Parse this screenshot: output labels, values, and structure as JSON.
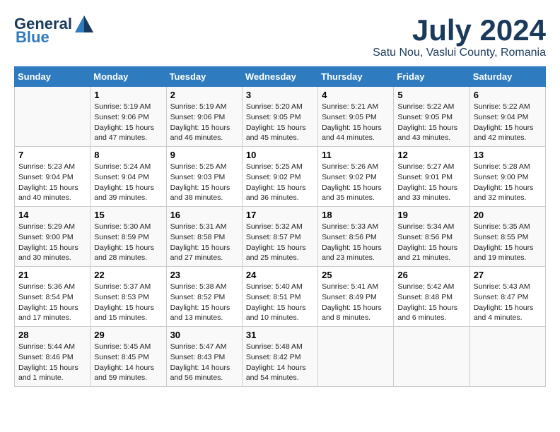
{
  "header": {
    "logo_general": "General",
    "logo_blue": "Blue",
    "month": "July 2024",
    "location": "Satu Nou, Vaslui County, Romania"
  },
  "days_of_week": [
    "Sunday",
    "Monday",
    "Tuesday",
    "Wednesday",
    "Thursday",
    "Friday",
    "Saturday"
  ],
  "weeks": [
    [
      {
        "day": "",
        "sunrise": "",
        "sunset": "",
        "daylight": ""
      },
      {
        "day": "1",
        "sunrise": "Sunrise: 5:19 AM",
        "sunset": "Sunset: 9:06 PM",
        "daylight": "Daylight: 15 hours and 47 minutes."
      },
      {
        "day": "2",
        "sunrise": "Sunrise: 5:19 AM",
        "sunset": "Sunset: 9:06 PM",
        "daylight": "Daylight: 15 hours and 46 minutes."
      },
      {
        "day": "3",
        "sunrise": "Sunrise: 5:20 AM",
        "sunset": "Sunset: 9:05 PM",
        "daylight": "Daylight: 15 hours and 45 minutes."
      },
      {
        "day": "4",
        "sunrise": "Sunrise: 5:21 AM",
        "sunset": "Sunset: 9:05 PM",
        "daylight": "Daylight: 15 hours and 44 minutes."
      },
      {
        "day": "5",
        "sunrise": "Sunrise: 5:22 AM",
        "sunset": "Sunset: 9:05 PM",
        "daylight": "Daylight: 15 hours and 43 minutes."
      },
      {
        "day": "6",
        "sunrise": "Sunrise: 5:22 AM",
        "sunset": "Sunset: 9:04 PM",
        "daylight": "Daylight: 15 hours and 42 minutes."
      }
    ],
    [
      {
        "day": "7",
        "sunrise": "Sunrise: 5:23 AM",
        "sunset": "Sunset: 9:04 PM",
        "daylight": "Daylight: 15 hours and 40 minutes."
      },
      {
        "day": "8",
        "sunrise": "Sunrise: 5:24 AM",
        "sunset": "Sunset: 9:04 PM",
        "daylight": "Daylight: 15 hours and 39 minutes."
      },
      {
        "day": "9",
        "sunrise": "Sunrise: 5:25 AM",
        "sunset": "Sunset: 9:03 PM",
        "daylight": "Daylight: 15 hours and 38 minutes."
      },
      {
        "day": "10",
        "sunrise": "Sunrise: 5:25 AM",
        "sunset": "Sunset: 9:02 PM",
        "daylight": "Daylight: 15 hours and 36 minutes."
      },
      {
        "day": "11",
        "sunrise": "Sunrise: 5:26 AM",
        "sunset": "Sunset: 9:02 PM",
        "daylight": "Daylight: 15 hours and 35 minutes."
      },
      {
        "day": "12",
        "sunrise": "Sunrise: 5:27 AM",
        "sunset": "Sunset: 9:01 PM",
        "daylight": "Daylight: 15 hours and 33 minutes."
      },
      {
        "day": "13",
        "sunrise": "Sunrise: 5:28 AM",
        "sunset": "Sunset: 9:00 PM",
        "daylight": "Daylight: 15 hours and 32 minutes."
      }
    ],
    [
      {
        "day": "14",
        "sunrise": "Sunrise: 5:29 AM",
        "sunset": "Sunset: 9:00 PM",
        "daylight": "Daylight: 15 hours and 30 minutes."
      },
      {
        "day": "15",
        "sunrise": "Sunrise: 5:30 AM",
        "sunset": "Sunset: 8:59 PM",
        "daylight": "Daylight: 15 hours and 28 minutes."
      },
      {
        "day": "16",
        "sunrise": "Sunrise: 5:31 AM",
        "sunset": "Sunset: 8:58 PM",
        "daylight": "Daylight: 15 hours and 27 minutes."
      },
      {
        "day": "17",
        "sunrise": "Sunrise: 5:32 AM",
        "sunset": "Sunset: 8:57 PM",
        "daylight": "Daylight: 15 hours and 25 minutes."
      },
      {
        "day": "18",
        "sunrise": "Sunrise: 5:33 AM",
        "sunset": "Sunset: 8:56 PM",
        "daylight": "Daylight: 15 hours and 23 minutes."
      },
      {
        "day": "19",
        "sunrise": "Sunrise: 5:34 AM",
        "sunset": "Sunset: 8:56 PM",
        "daylight": "Daylight: 15 hours and 21 minutes."
      },
      {
        "day": "20",
        "sunrise": "Sunrise: 5:35 AM",
        "sunset": "Sunset: 8:55 PM",
        "daylight": "Daylight: 15 hours and 19 minutes."
      }
    ],
    [
      {
        "day": "21",
        "sunrise": "Sunrise: 5:36 AM",
        "sunset": "Sunset: 8:54 PM",
        "daylight": "Daylight: 15 hours and 17 minutes."
      },
      {
        "day": "22",
        "sunrise": "Sunrise: 5:37 AM",
        "sunset": "Sunset: 8:53 PM",
        "daylight": "Daylight: 15 hours and 15 minutes."
      },
      {
        "day": "23",
        "sunrise": "Sunrise: 5:38 AM",
        "sunset": "Sunset: 8:52 PM",
        "daylight": "Daylight: 15 hours and 13 minutes."
      },
      {
        "day": "24",
        "sunrise": "Sunrise: 5:40 AM",
        "sunset": "Sunset: 8:51 PM",
        "daylight": "Daylight: 15 hours and 10 minutes."
      },
      {
        "day": "25",
        "sunrise": "Sunrise: 5:41 AM",
        "sunset": "Sunset: 8:49 PM",
        "daylight": "Daylight: 15 hours and 8 minutes."
      },
      {
        "day": "26",
        "sunrise": "Sunrise: 5:42 AM",
        "sunset": "Sunset: 8:48 PM",
        "daylight": "Daylight: 15 hours and 6 minutes."
      },
      {
        "day": "27",
        "sunrise": "Sunrise: 5:43 AM",
        "sunset": "Sunset: 8:47 PM",
        "daylight": "Daylight: 15 hours and 4 minutes."
      }
    ],
    [
      {
        "day": "28",
        "sunrise": "Sunrise: 5:44 AM",
        "sunset": "Sunset: 8:46 PM",
        "daylight": "Daylight: 15 hours and 1 minute."
      },
      {
        "day": "29",
        "sunrise": "Sunrise: 5:45 AM",
        "sunset": "Sunset: 8:45 PM",
        "daylight": "Daylight: 14 hours and 59 minutes."
      },
      {
        "day": "30",
        "sunrise": "Sunrise: 5:47 AM",
        "sunset": "Sunset: 8:43 PM",
        "daylight": "Daylight: 14 hours and 56 minutes."
      },
      {
        "day": "31",
        "sunrise": "Sunrise: 5:48 AM",
        "sunset": "Sunset: 8:42 PM",
        "daylight": "Daylight: 14 hours and 54 minutes."
      },
      {
        "day": "",
        "sunrise": "",
        "sunset": "",
        "daylight": ""
      },
      {
        "day": "",
        "sunrise": "",
        "sunset": "",
        "daylight": ""
      },
      {
        "day": "",
        "sunrise": "",
        "sunset": "",
        "daylight": ""
      }
    ]
  ]
}
